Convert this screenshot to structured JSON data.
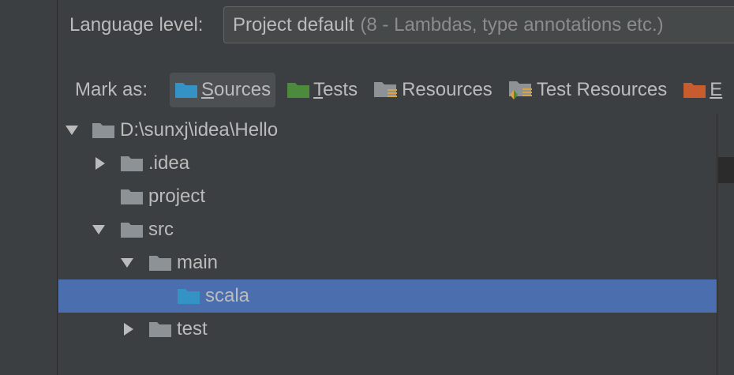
{
  "language": {
    "label": "Language level:",
    "value": "Project default",
    "hint": "(8 - Lambdas, type annotations etc.)"
  },
  "mark_as": {
    "label": "Mark as:",
    "buttons": [
      {
        "first": "S",
        "rest": "ources",
        "icon": "sources-folder-icon",
        "color": "#3592c4"
      },
      {
        "first": "T",
        "rest": "ests",
        "icon": "tests-folder-icon",
        "color": "#4b8b3b"
      },
      {
        "first": "",
        "rest": "Resources",
        "icon": "resources-folder-icon",
        "color": "#8c9295"
      },
      {
        "first": "",
        "rest": "Test Resources",
        "icon": "test-resources-folder-icon",
        "color": "#8c9295"
      },
      {
        "first": "E",
        "rest": "",
        "icon": "excluded-folder-icon",
        "color": "#c75c2e"
      }
    ]
  },
  "tree": {
    "root": "D:\\sunxj\\idea\\Hello",
    "idea": ".idea",
    "project": "project",
    "src": "src",
    "main": "main",
    "scala": "scala",
    "test": "test"
  },
  "colors": {
    "background": "#3c3f41",
    "selection": "#4b6eaf",
    "sources_folder": "#3592c4",
    "plain_folder": "#8c9295"
  }
}
